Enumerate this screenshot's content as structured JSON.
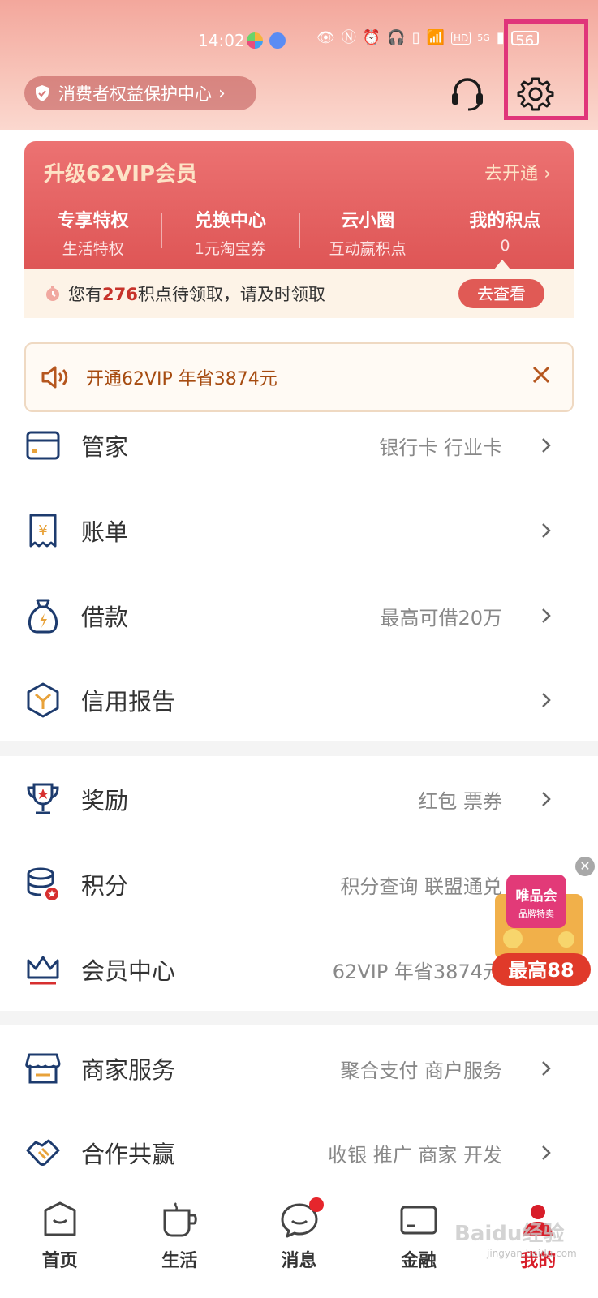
{
  "status_bar": {
    "time": "14:02",
    "battery": "56",
    "network": "5G",
    "hd": "HD"
  },
  "header": {
    "consumer_center": "消费者权益保护中心",
    "icons": [
      "shield-icon",
      "headset-icon",
      "gear-icon"
    ]
  },
  "vip": {
    "title": "升级62VIP会员",
    "open_label": "去开通",
    "columns": [
      {
        "title": "专享特权",
        "sub": "生活特权"
      },
      {
        "title": "兑换中心",
        "sub": "1元淘宝券"
      },
      {
        "title": "云小圈",
        "sub": "互动赢积点"
      },
      {
        "title": "我的积点",
        "sub": "0"
      }
    ],
    "points_prefix": "您有",
    "points_count": "276",
    "points_suffix": "积点待领取，请及时领取",
    "points_button": "去查看"
  },
  "banner": {
    "text": "开通62VIP 年省3874元"
  },
  "menu": [
    {
      "label": "管家",
      "sub": "银行卡 行业卡",
      "icon": "card-icon"
    },
    {
      "label": "账单",
      "sub": "",
      "icon": "bill-icon"
    },
    {
      "label": "借款",
      "sub": "最高可借20万",
      "icon": "loan-bag-icon"
    },
    {
      "label": "信用报告",
      "sub": "",
      "icon": "credit-report-icon"
    },
    {
      "label": "奖励",
      "sub": "红包 票券",
      "icon": "trophy-icon"
    },
    {
      "label": "积分",
      "sub": "积分查询 联盟通兑",
      "icon": "points-coins-icon"
    },
    {
      "label": "会员中心",
      "sub": "62VIP 年省3874元",
      "icon": "crown-icon"
    },
    {
      "label": "商家服务",
      "sub": "聚合支付 商户服务",
      "icon": "store-icon"
    },
    {
      "label": "合作共赢",
      "sub": "收银 推广 商家 开发",
      "icon": "handshake-icon"
    }
  ],
  "float_ad": {
    "brand": "唯品会",
    "tagline": "品牌特卖",
    "promo": "最高88"
  },
  "tabs": [
    {
      "label": "首页",
      "icon": "home-icon",
      "active": false
    },
    {
      "label": "生活",
      "icon": "cup-icon",
      "active": false
    },
    {
      "label": "消息",
      "icon": "message-icon",
      "active": false,
      "badge": true
    },
    {
      "label": "金融",
      "icon": "finance-card-icon",
      "active": false
    },
    {
      "label": "我的",
      "icon": "profile-icon",
      "active": true
    }
  ],
  "watermark": {
    "main": "Baidu经验",
    "sub": "jingyan.baidu.com"
  },
  "colors": {
    "accent_red": "#e05a55",
    "vip_red": "#de5555",
    "icon_navy": "#1d3b6e",
    "active_tab": "#d81e2a",
    "highlight": "#e0357a"
  }
}
